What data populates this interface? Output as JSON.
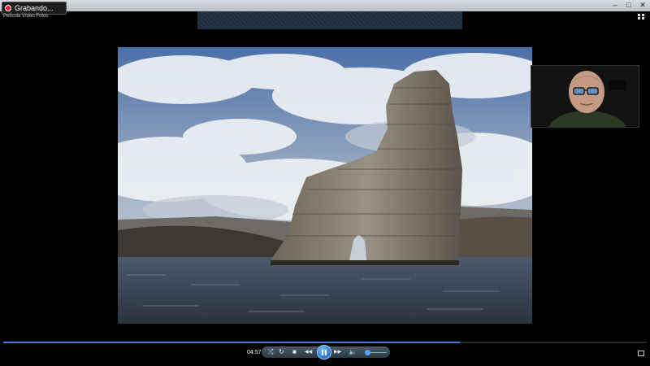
{
  "recording": {
    "label": "Grabando..."
  },
  "window": {
    "title": "Película Vídeo Fotos",
    "controls": [
      "–",
      "□",
      "✕"
    ]
  },
  "player": {
    "elapsed": "04:57",
    "progress_fraction": 0.71,
    "volume_fraction": 0.15,
    "buttons": {
      "shuffle": "⤮",
      "repeat": "↻",
      "stop": "■",
      "previous": "◀◀",
      "next": "▶▶",
      "mute": "🔈"
    }
  },
  "icons": [
    "record-icon",
    "shuffle-icon",
    "repeat-icon",
    "stop-icon",
    "previous-icon",
    "pause-icon",
    "next-icon",
    "volume-icon",
    "fullscreen-icon",
    "switch-view-icon"
  ],
  "colors": {
    "progress": "#3d7fd6",
    "play_button": "#1f6ed1",
    "background": "#000000"
  }
}
